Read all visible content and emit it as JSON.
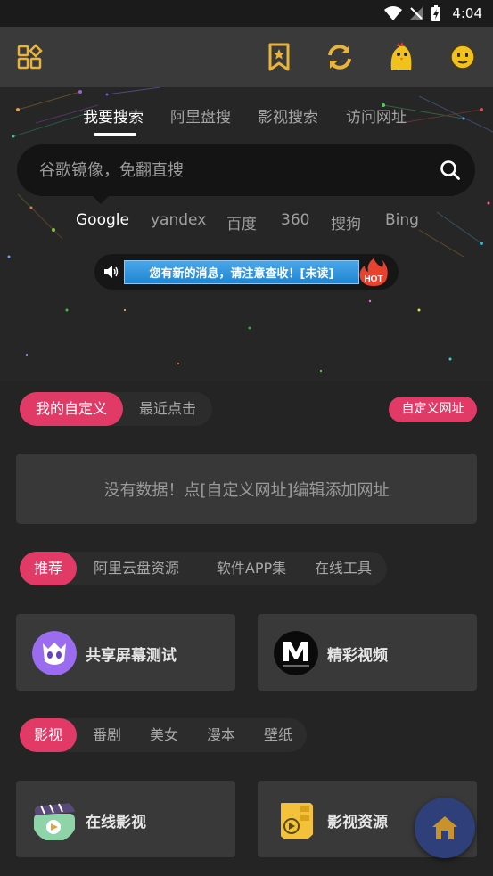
{
  "status_bar": {
    "time": "4:04"
  },
  "app_bar": {
    "icons": [
      "grid-menu-icon",
      "bookmark-star-icon",
      "refresh-icon",
      "chicken-avatar-icon",
      "smiley-icon"
    ]
  },
  "search": {
    "tabs": [
      {
        "label": "我要搜索",
        "active": true
      },
      {
        "label": "阿里盘搜",
        "active": false
      },
      {
        "label": "影视搜索",
        "active": false
      },
      {
        "label": "访问网址",
        "active": false
      }
    ],
    "placeholder": "谷歌镜像，免翻直搜",
    "engines": [
      {
        "label": "Google",
        "active": true
      },
      {
        "label": "yandex",
        "active": false
      },
      {
        "label": "百度",
        "active": false
      },
      {
        "label": "360",
        "active": false
      },
      {
        "label": "搜狗",
        "active": false
      },
      {
        "label": "Bing",
        "active": false
      }
    ]
  },
  "notice": {
    "text": "您有新的消息，请注意查收！[未读]",
    "badge": "HOT"
  },
  "custom_section": {
    "tabs": [
      {
        "label": "我的自定义",
        "active": true
      },
      {
        "label": "最近点击",
        "active": false
      }
    ],
    "button": "自定义网址",
    "empty_text": "没有数据！点[自定义网址]编辑添加网址"
  },
  "recommend_section": {
    "tabs": [
      {
        "label": "推荐",
        "active": true
      },
      {
        "label": "阿里云盘资源",
        "active": false
      },
      {
        "label": "软件APP集",
        "active": false
      },
      {
        "label": "在线工具",
        "active": false
      }
    ],
    "cards": [
      {
        "title": "共享屏幕测试",
        "icon": "purple-mascot-icon"
      },
      {
        "title": "精彩视频",
        "icon": "m-logo-icon"
      }
    ]
  },
  "video_section": {
    "tabs": [
      {
        "label": "影视",
        "active": true
      },
      {
        "label": "番剧",
        "active": false
      },
      {
        "label": "美女",
        "active": false
      },
      {
        "label": "漫本",
        "active": false
      },
      {
        "label": "壁纸",
        "active": false
      }
    ],
    "cards": [
      {
        "title": "在线影视",
        "icon": "clapperboard-play-icon"
      },
      {
        "title": "影视资源",
        "icon": "film-reel-icon"
      }
    ]
  },
  "colors": {
    "accent": "#e23a67",
    "background": "#242424",
    "fab": "#2f3f7a"
  }
}
